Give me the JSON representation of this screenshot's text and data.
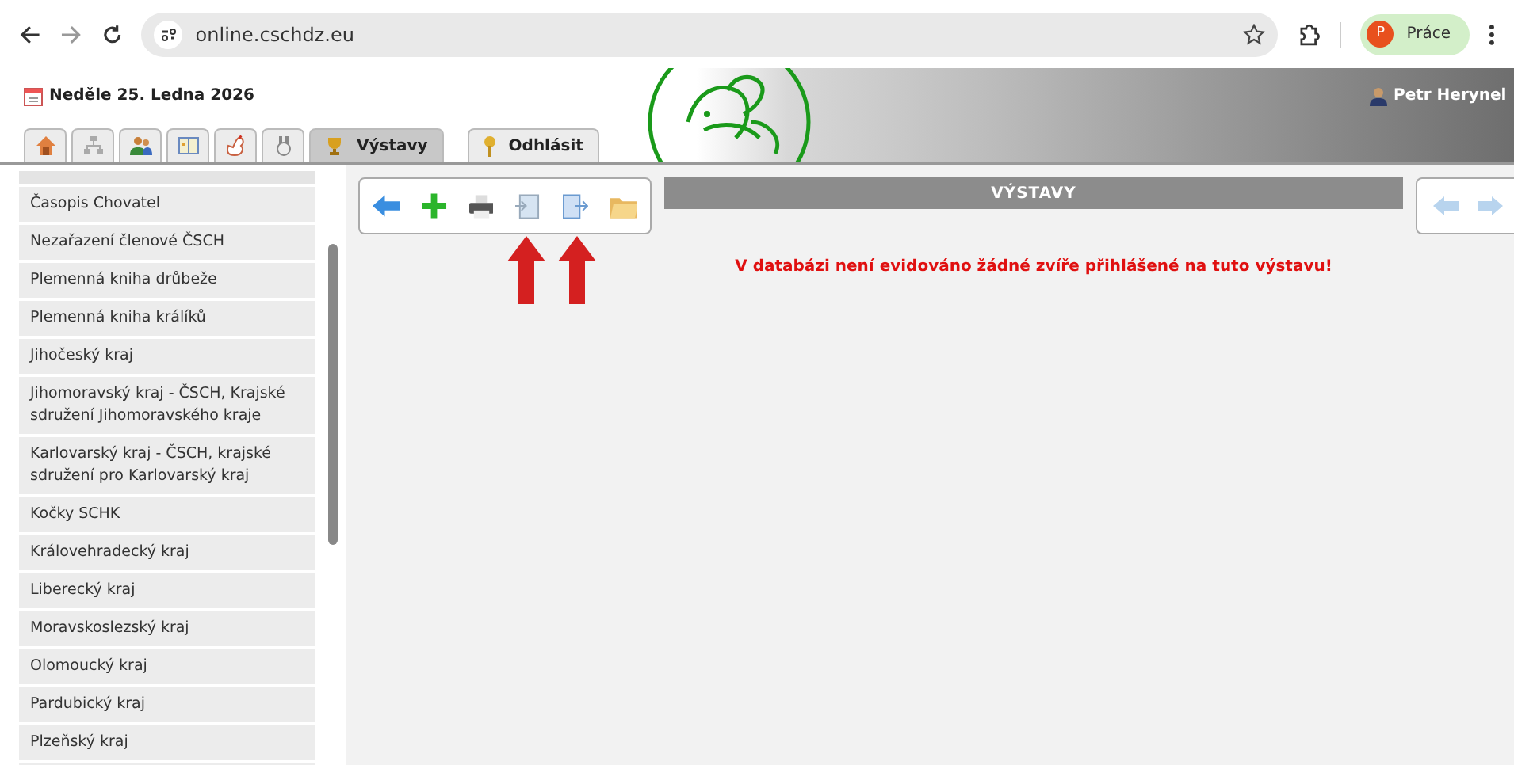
{
  "browser": {
    "url": "online.cschdz.eu",
    "profile_initial": "P",
    "profile_label": "Práce"
  },
  "header": {
    "date": "Neděle 25. Ledna 2026",
    "user": "Petr Herynel"
  },
  "tabs": [
    {
      "kind": "icon",
      "selected": false
    },
    {
      "kind": "icon",
      "selected": false
    },
    {
      "kind": "icon",
      "selected": false
    },
    {
      "kind": "icon",
      "selected": false
    },
    {
      "kind": "icon",
      "selected": false
    },
    {
      "kind": "icon",
      "selected": false
    },
    {
      "kind": "text",
      "label": "Výstavy",
      "selected": true
    },
    {
      "kind": "text",
      "label": "Odhlásit",
      "selected": false
    }
  ],
  "sidebar": {
    "items": [
      "Časopis Chovatel",
      "Nezařazení členové ČSCH",
      "Plemenná kniha drůbeže",
      "Plemenná kniha králíků",
      "Jihočeský kraj",
      "Jihomoravský kraj - ČSCH, Krajské sdružení Jihomoravského kraje",
      "Karlovarský kraj - ČSCH, krajské sdružení pro Karlovarský kraj",
      "Kočky SCHK",
      "Královehradecký kraj",
      "Liberecký kraj",
      "Moravskoslezský kraj",
      "Olomoucký kraj",
      "Pardubický kraj",
      "Plzeňský kraj"
    ]
  },
  "main": {
    "title": "VÝSTAVY",
    "message": "V databázi není evidováno žádné zvíře přihlášené na tuto výstavu!"
  }
}
